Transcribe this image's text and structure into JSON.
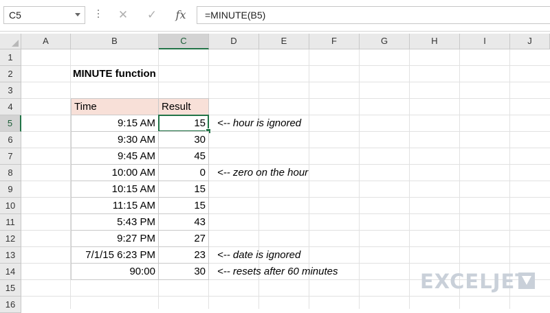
{
  "formula_bar": {
    "name_box": "C5",
    "cancel_icon": "✕",
    "enter_icon": "✓",
    "fx_label": "fx",
    "formula": "=MINUTE(B5)"
  },
  "columns": [
    "A",
    "B",
    "C",
    "D",
    "E",
    "F",
    "G",
    "H",
    "I",
    "J"
  ],
  "rows": [
    "1",
    "2",
    "3",
    "4",
    "5",
    "6",
    "7",
    "8",
    "9",
    "10",
    "11",
    "12",
    "13",
    "14",
    "15",
    "16"
  ],
  "sheet": {
    "title": "MINUTE function",
    "headers": {
      "time": "Time",
      "result": "Result"
    },
    "data": [
      {
        "time": "9:15 AM",
        "result": "15"
      },
      {
        "time": "9:30 AM",
        "result": "30"
      },
      {
        "time": "9:45 AM",
        "result": "45"
      },
      {
        "time": "10:00 AM",
        "result": "0"
      },
      {
        "time": "10:15 AM",
        "result": "15"
      },
      {
        "time": "11:15 AM",
        "result": "15"
      },
      {
        "time": "5:43 PM",
        "result": "43"
      },
      {
        "time": "9:27 PM",
        "result": "27"
      },
      {
        "time": "7/1/15 6:23 PM",
        "result": "23"
      },
      {
        "time": "90:00",
        "result": "30"
      }
    ],
    "notes": {
      "row5": "<-- hour is ignored",
      "row8": "<-- zero on the hour",
      "row13": "<-- date is ignored",
      "row14": "<-- resets after 60 minutes"
    }
  },
  "watermark": {
    "text": "EXCELJET"
  },
  "colors": {
    "accent": "#217346",
    "header_fill": "#f8e0d8"
  }
}
